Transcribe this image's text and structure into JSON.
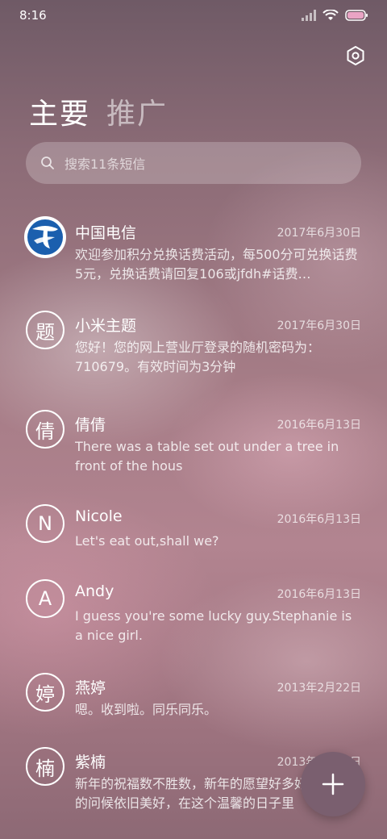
{
  "status_bar": {
    "time": "8:16",
    "icons": [
      "signal-icon",
      "wifi-icon",
      "battery-icon"
    ]
  },
  "header": {
    "settings_icon": "settings-icon",
    "tabs": [
      {
        "label": "主要",
        "active": true
      },
      {
        "label": "推广",
        "active": false
      }
    ]
  },
  "search": {
    "placeholder": "搜索11条短信"
  },
  "messages": [
    {
      "avatar": "",
      "avatar_icon": "china-telecom-logo",
      "name": "中国电信",
      "date": "2017年6月30日",
      "preview": "欢迎参加积分兑换话费活动，每500分可兑换话费5元，兑换话费请回复106或jfdh#话费…"
    },
    {
      "avatar": "题",
      "name": "小米主题",
      "date": "2017年6月30日",
      "preview": "您好！您的网上营业厅登录的随机密码为：710679。有效时间为3分钟"
    },
    {
      "avatar": "倩",
      "name": "倩倩",
      "date": "2016年6月13日",
      "preview": "There was a table set out under a tree in front of the hous"
    },
    {
      "avatar": "N",
      "name": "Nicole",
      "date": "2016年6月13日",
      "preview": "Let's eat out,shall we?"
    },
    {
      "avatar": "A",
      "name": "Andy",
      "date": "2016年6月13日",
      "preview": "I guess you're some lucky guy.Stephanie is a nice girl."
    },
    {
      "avatar": "婷",
      "name": "燕婷",
      "date": "2013年2月22日",
      "preview": "嗯。收到啦。同乐同乐。"
    },
    {
      "avatar": "楠",
      "name": "紫楠",
      "date": "2013年2月22日",
      "preview": "新年的祝福数不胜数，新年的愿望好多好多，新年的问候依旧美好，在这个温馨的日子里"
    }
  ],
  "fab": {
    "icon": "plus-icon"
  },
  "colors": {
    "fab_bg": "#7a5f6f",
    "text_primary": "#ffffff",
    "telecom_blue": "#1b5fae"
  }
}
